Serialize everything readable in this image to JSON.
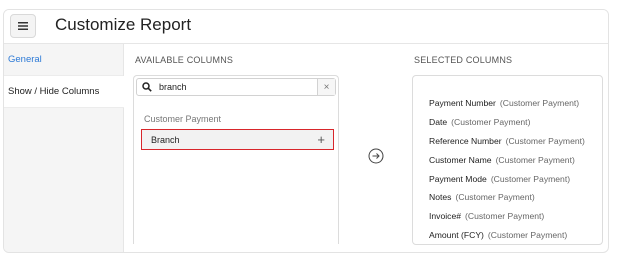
{
  "header": {
    "title": "Customize Report"
  },
  "sidebar": {
    "items": [
      {
        "label": "General"
      },
      {
        "label": "Show / Hide Columns"
      }
    ]
  },
  "available": {
    "label": "AVAILABLE COLUMNS",
    "search_value": "branch",
    "clear_symbol": "×",
    "group_label": "Customer Payment",
    "items": [
      {
        "label": "Branch",
        "action_symbol": "+"
      }
    ]
  },
  "selected": {
    "label": "SELECTED COLUMNS",
    "items": [
      {
        "name": "Payment Number",
        "source": "(Customer Payment)"
      },
      {
        "name": "Date",
        "source": "(Customer Payment)"
      },
      {
        "name": "Reference Number",
        "source": "(Customer Payment)"
      },
      {
        "name": "Customer Name",
        "source": "(Customer Payment)"
      },
      {
        "name": "Payment Mode",
        "source": "(Customer Payment)"
      },
      {
        "name": "Notes",
        "source": "(Customer Payment)"
      },
      {
        "name": "Invoice#",
        "source": "(Customer Payment)"
      },
      {
        "name": "Amount (FCY)",
        "source": "(Customer Payment)"
      }
    ]
  },
  "colors": {
    "accent": "#2d7ad6",
    "highlight_border": "#d8262b"
  },
  "icons": {
    "menu": "hamburger-menu-icon",
    "search": "search-icon",
    "transfer": "arrow-right-circle-icon"
  }
}
